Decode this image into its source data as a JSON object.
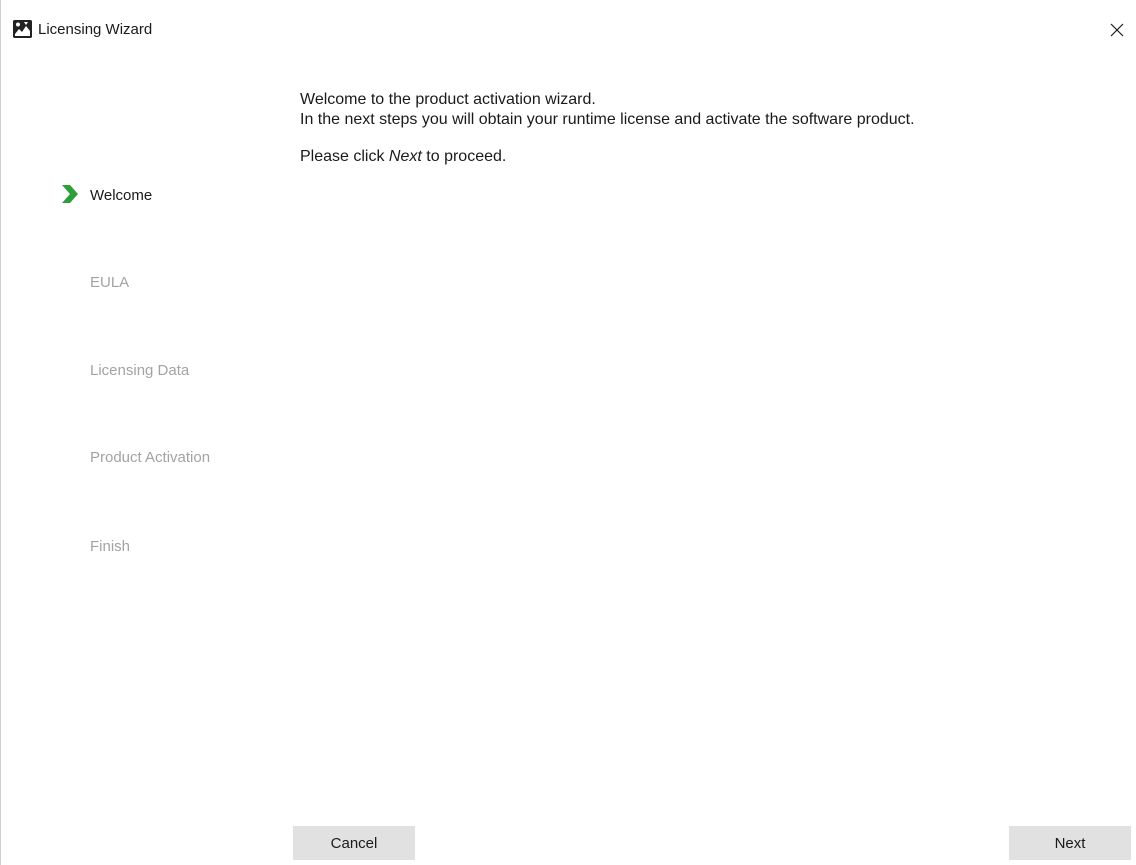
{
  "window": {
    "title": "Licensing Wizard",
    "close_glyph": "✕",
    "icon": "app-logo-icon"
  },
  "steps": [
    {
      "label": "Welcome",
      "state": "current"
    },
    {
      "label": "EULA",
      "state": "pending"
    },
    {
      "label": "Licensing Data",
      "state": "pending"
    },
    {
      "label": "Product Activation",
      "state": "pending"
    },
    {
      "label": "Finish",
      "state": "pending"
    }
  ],
  "content": {
    "line1": "Welcome to the product activation wizard.",
    "line2": "In the next steps you will obtain your runtime license and activate the software product.",
    "instruction_prefix": "Please click ",
    "instruction_emphasis": "Next",
    "instruction_suffix": " to proceed."
  },
  "buttons": {
    "cancel_label": "Cancel",
    "next_label": "Next"
  },
  "colors": {
    "current_step_arrow": "#2e9e3a",
    "current_step_text": "#1a1a1a",
    "pending_step_text": "#a3a3a3",
    "button_background": "#e1e1e1"
  }
}
